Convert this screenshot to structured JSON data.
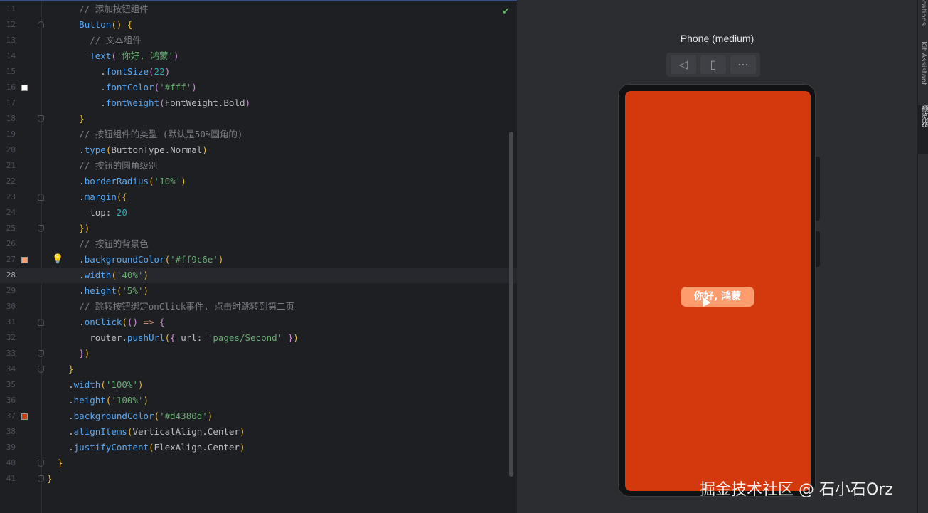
{
  "editor": {
    "lines": [
      {
        "n": "11",
        "indent": 6,
        "tokens": [
          [
            "cm",
            "// 添加按钮组件"
          ]
        ]
      },
      {
        "n": "12",
        "indent": 6,
        "fold": "open",
        "tokens": [
          [
            "fn",
            "Button"
          ],
          [
            "p1",
            "()"
          ],
          [
            "p3",
            " "
          ],
          [
            "p1",
            "{"
          ]
        ]
      },
      {
        "n": "13",
        "indent": 8,
        "tokens": [
          [
            "cm",
            "// 文本组件"
          ]
        ]
      },
      {
        "n": "14",
        "indent": 8,
        "tokens": [
          [
            "fn",
            "Text"
          ],
          [
            "p2",
            "("
          ],
          [
            "st",
            "'你好, 鸿蒙'"
          ],
          [
            "p2",
            ")"
          ]
        ]
      },
      {
        "n": "15",
        "indent": 10,
        "tokens": [
          [
            "p3",
            "."
          ],
          [
            "fn",
            "fontSize"
          ],
          [
            "p2",
            "("
          ],
          [
            "num",
            "22"
          ],
          [
            "p2",
            ")"
          ]
        ]
      },
      {
        "n": "16",
        "indent": 10,
        "swatch": "#ffffff",
        "tokens": [
          [
            "p3",
            "."
          ],
          [
            "fn",
            "fontColor"
          ],
          [
            "p2",
            "("
          ],
          [
            "st",
            "'#fff'"
          ],
          [
            "p2",
            ")"
          ]
        ]
      },
      {
        "n": "17",
        "indent": 10,
        "tokens": [
          [
            "p3",
            "."
          ],
          [
            "fn",
            "fontWeight"
          ],
          [
            "p2",
            "("
          ],
          [
            "p3",
            "FontWeight.Bold"
          ],
          [
            "p2",
            ")"
          ]
        ]
      },
      {
        "n": "18",
        "indent": 6,
        "fold": "close",
        "tokens": [
          [
            "p1",
            "}"
          ]
        ]
      },
      {
        "n": "19",
        "indent": 6,
        "tokens": [
          [
            "cm",
            "// 按钮组件的类型 (默认是50%圆角的)"
          ]
        ]
      },
      {
        "n": "20",
        "indent": 6,
        "tokens": [
          [
            "p3",
            "."
          ],
          [
            "fn",
            "type"
          ],
          [
            "p1",
            "("
          ],
          [
            "p3",
            "ButtonType.Normal"
          ],
          [
            "p1",
            ")"
          ]
        ]
      },
      {
        "n": "21",
        "indent": 6,
        "tokens": [
          [
            "cm",
            "// 按钮的圆角级别"
          ]
        ]
      },
      {
        "n": "22",
        "indent": 6,
        "tokens": [
          [
            "p3",
            "."
          ],
          [
            "fn",
            "borderRadius"
          ],
          [
            "p1",
            "("
          ],
          [
            "st",
            "'10%'"
          ],
          [
            "p1",
            ")"
          ]
        ]
      },
      {
        "n": "23",
        "indent": 6,
        "fold": "open",
        "tokens": [
          [
            "p3",
            "."
          ],
          [
            "fn",
            "margin"
          ],
          [
            "p1",
            "({"
          ]
        ]
      },
      {
        "n": "24",
        "indent": 8,
        "tokens": [
          [
            "p3",
            "top: "
          ],
          [
            "num",
            "20"
          ]
        ]
      },
      {
        "n": "25",
        "indent": 6,
        "fold": "close",
        "tokens": [
          [
            "p1",
            "})"
          ]
        ]
      },
      {
        "n": "26",
        "indent": 6,
        "tokens": [
          [
            "cm",
            "// 按钮的背景色"
          ]
        ]
      },
      {
        "n": "27",
        "indent": 6,
        "swatch": "#ff9c6e",
        "bulb": true,
        "tokens": [
          [
            "p3",
            "."
          ],
          [
            "fn",
            "backgroundColor"
          ],
          [
            "p1",
            "("
          ],
          [
            "st",
            "'#ff9c6e'"
          ],
          [
            "p1",
            ")"
          ]
        ]
      },
      {
        "n": "28",
        "indent": 6,
        "active": true,
        "tokens": [
          [
            "p3",
            "."
          ],
          [
            "fn",
            "width"
          ],
          [
            "p1",
            "("
          ],
          [
            "st",
            "'40%'"
          ],
          [
            "p1",
            ")"
          ]
        ]
      },
      {
        "n": "29",
        "indent": 6,
        "tokens": [
          [
            "p3",
            "."
          ],
          [
            "fn",
            "height"
          ],
          [
            "p1",
            "("
          ],
          [
            "st",
            "'5%'"
          ],
          [
            "p1",
            ")"
          ]
        ]
      },
      {
        "n": "30",
        "indent": 6,
        "tokens": [
          [
            "cm",
            "// 跳转按钮绑定onClick事件, 点击时跳转到第二页"
          ]
        ]
      },
      {
        "n": "31",
        "indent": 6,
        "fold": "open",
        "tokens": [
          [
            "p3",
            "."
          ],
          [
            "fn",
            "onClick"
          ],
          [
            "p1",
            "("
          ],
          [
            "p2",
            "()"
          ],
          [
            "p3",
            " "
          ],
          [
            "kw",
            "=>"
          ],
          [
            "p3",
            " "
          ],
          [
            "p2",
            "{"
          ]
        ]
      },
      {
        "n": "32",
        "indent": 8,
        "tokens": [
          [
            "p3",
            "router."
          ],
          [
            "fn",
            "pushUrl"
          ],
          [
            "p1",
            "("
          ],
          [
            "p2",
            "{"
          ],
          [
            "p3",
            " url: "
          ],
          [
            "st",
            "'pages/Second'"
          ],
          [
            "p3",
            " "
          ],
          [
            "p2",
            "}"
          ],
          [
            "p1",
            ")"
          ]
        ]
      },
      {
        "n": "33",
        "indent": 6,
        "fold": "close",
        "tokens": [
          [
            "p2",
            "}"
          ],
          [
            "p1",
            ")"
          ]
        ]
      },
      {
        "n": "34",
        "indent": 4,
        "fold": "close",
        "tokens": [
          [
            "p1",
            "}"
          ]
        ]
      },
      {
        "n": "35",
        "indent": 4,
        "tokens": [
          [
            "p3",
            "."
          ],
          [
            "fn",
            "width"
          ],
          [
            "p1",
            "("
          ],
          [
            "st",
            "'100%'"
          ],
          [
            "p1",
            ")"
          ]
        ]
      },
      {
        "n": "36",
        "indent": 4,
        "tokens": [
          [
            "p3",
            "."
          ],
          [
            "fn",
            "height"
          ],
          [
            "p1",
            "("
          ],
          [
            "st",
            "'100%'"
          ],
          [
            "p1",
            ")"
          ]
        ]
      },
      {
        "n": "37",
        "indent": 4,
        "swatch": "#d4380d",
        "tokens": [
          [
            "p3",
            "."
          ],
          [
            "fn",
            "backgroundColor"
          ],
          [
            "p1",
            "("
          ],
          [
            "st",
            "'#d4380d'"
          ],
          [
            "p1",
            ")"
          ]
        ]
      },
      {
        "n": "38",
        "indent": 4,
        "tokens": [
          [
            "p3",
            "."
          ],
          [
            "fn",
            "alignItems"
          ],
          [
            "p1",
            "("
          ],
          [
            "p3",
            "VerticalAlign.Center"
          ],
          [
            "p1",
            ")"
          ]
        ]
      },
      {
        "n": "39",
        "indent": 4,
        "tokens": [
          [
            "p3",
            "."
          ],
          [
            "fn",
            "justifyContent"
          ],
          [
            "p1",
            "("
          ],
          [
            "p3",
            "FlexAlign.Center"
          ],
          [
            "p1",
            ")"
          ]
        ]
      },
      {
        "n": "40",
        "indent": 2,
        "fold": "close",
        "tokens": [
          [
            "p1",
            "}"
          ]
        ]
      },
      {
        "n": "41",
        "indent": 0,
        "fold": "close",
        "tokens": [
          [
            "p1",
            "}"
          ]
        ]
      }
    ],
    "status_icon": "checkmark-icon"
  },
  "previewer": {
    "device_title": "Phone (medium)",
    "toolbar": [
      {
        "name": "back-icon",
        "glyph": "◁"
      },
      {
        "name": "rotate-icon",
        "glyph": "▯"
      },
      {
        "name": "more-icon",
        "glyph": "⋯"
      }
    ],
    "screen_color": "#d4380d",
    "button": {
      "label": "你好, 鸿蒙",
      "color": "#ff9c6e"
    }
  },
  "tool_strip": {
    "tabs": [
      "cations",
      "Kit Assistant",
      "预览器"
    ],
    "selected": "预览器"
  },
  "watermark": "掘金技术社区 @ 石小石Orz"
}
